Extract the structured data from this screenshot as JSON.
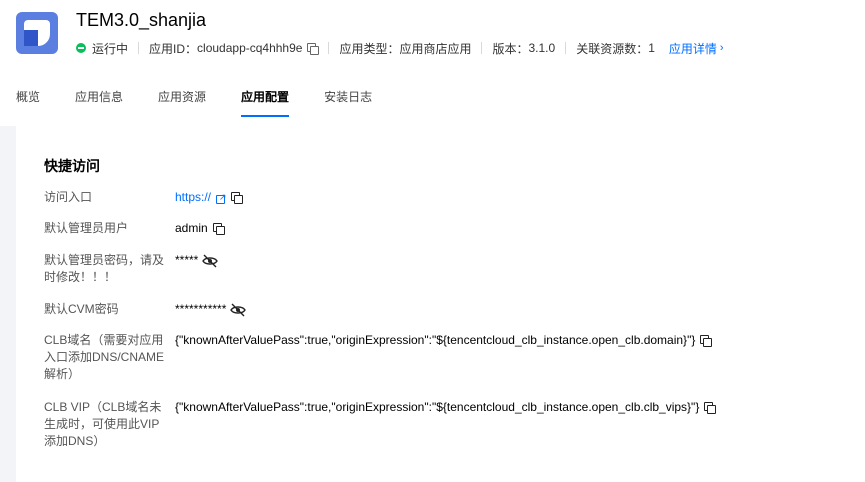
{
  "app": {
    "title": "TEM3.0_shanjia",
    "status": "运行中",
    "app_id_label": "应用ID：",
    "app_id": "cloudapp-cq4hhh9e",
    "type_label": "应用类型：",
    "type": "应用商店应用",
    "version_label": "版本：",
    "version": "3.1.0",
    "resources_label": "关联资源数：",
    "resources": "1",
    "details_link": "应用详情"
  },
  "tabs": [
    {
      "label": "概览"
    },
    {
      "label": "应用信息"
    },
    {
      "label": "应用资源"
    },
    {
      "label": "应用配置"
    },
    {
      "label": "安装日志"
    }
  ],
  "quick_access": {
    "title": "快捷访问",
    "rows": [
      {
        "label": "访问入口",
        "value": "https://"
      },
      {
        "label": "默认管理员用户",
        "value": "admin"
      },
      {
        "label": "默认管理员密码，请及时修改！！！",
        "value": "*****"
      },
      {
        "label": "默认CVM密码",
        "value": "***********"
      },
      {
        "label": "CLB域名（需要对应用入口添加DNS/CNAME解析）",
        "value": "{\"knownAfterValuePass\":true,\"originExpression\":\"${tencentcloud_clb_instance.open_clb.domain}\"}"
      },
      {
        "label": "CLB VIP（CLB域名未生成时，可使用此VIP添加DNS）",
        "value": "{\"knownAfterValuePass\":true,\"originExpression\":\"${tencentcloud_clb_instance.open_clb.clb_vips}\"}"
      }
    ]
  },
  "colors": {
    "accent": "#006eff",
    "status_green": "#0abf5b",
    "logo_blue": "#5b7fe0"
  }
}
